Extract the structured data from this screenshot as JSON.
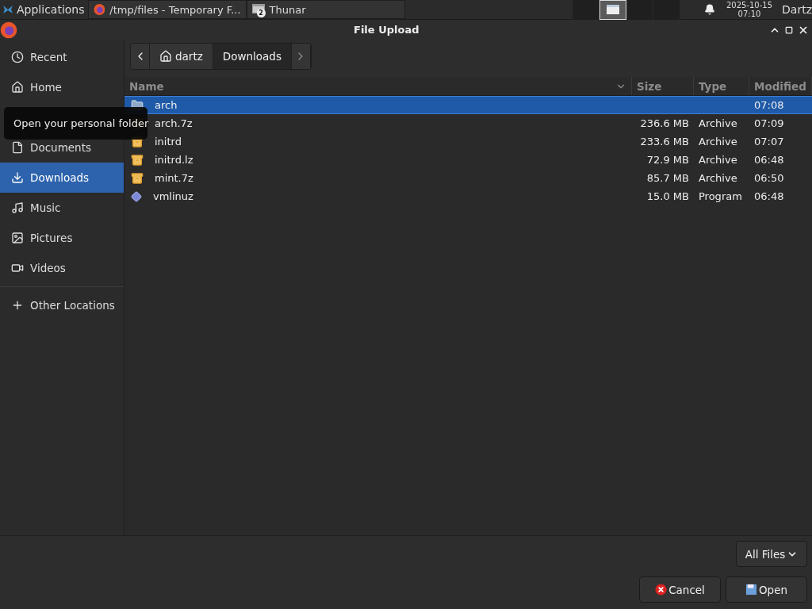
{
  "taskbar": {
    "menu": "Applications",
    "tasks": [
      {
        "title": "/tmp/files - Temporary F...",
        "kind": "browser"
      },
      {
        "title": "Thunar",
        "kind": "files",
        "badge": "2"
      }
    ],
    "date": "2025-10-15",
    "time": "07:10",
    "user": "Dartz"
  },
  "window": {
    "title": "File Upload"
  },
  "sidebar": {
    "items": [
      {
        "label": "Recent",
        "selected": false
      },
      {
        "label": "Home",
        "selected": false
      },
      {
        "selected": false
      },
      {
        "label": "Documents",
        "selected": false
      },
      {
        "label": "Downloads",
        "selected": true
      },
      {
        "label": "Music",
        "selected": false
      },
      {
        "label": "Pictures",
        "selected": false
      },
      {
        "label": "Videos",
        "selected": false
      }
    ],
    "other": "Other Locations"
  },
  "tooltip": "Open your personal folder",
  "path": [
    {
      "label": "dartz",
      "kind": "home",
      "selected": false
    },
    {
      "label": "Downloads",
      "kind": "plain",
      "selected": true
    }
  ],
  "table": {
    "columns": [
      "Name",
      "Size",
      "Type",
      "Modified"
    ],
    "rows": [
      {
        "name": "arch",
        "size": "",
        "type": "",
        "modified": "07:08",
        "kind": "folder",
        "selected": true
      },
      {
        "name": "arch.7z",
        "size": "236.6 MB",
        "type": "Archive",
        "modified": "07:09",
        "kind": "archive",
        "selected": false
      },
      {
        "name": "initrd",
        "size": "233.6 MB",
        "type": "Archive",
        "modified": "07:07",
        "kind": "archive",
        "selected": false
      },
      {
        "name": "initrd.lz",
        "size": "72.9 MB",
        "type": "Archive",
        "modified": "06:48",
        "kind": "archive",
        "selected": false
      },
      {
        "name": "mint.7z",
        "size": "85.7 MB",
        "type": "Archive",
        "modified": "06:50",
        "kind": "archive",
        "selected": false
      },
      {
        "name": "vmlinuz",
        "size": "15.0 MB",
        "type": "Program",
        "modified": "06:48",
        "kind": "program",
        "selected": false
      }
    ]
  },
  "filter": "All Files",
  "buttons": {
    "cancel": "Cancel",
    "open": "Open"
  }
}
